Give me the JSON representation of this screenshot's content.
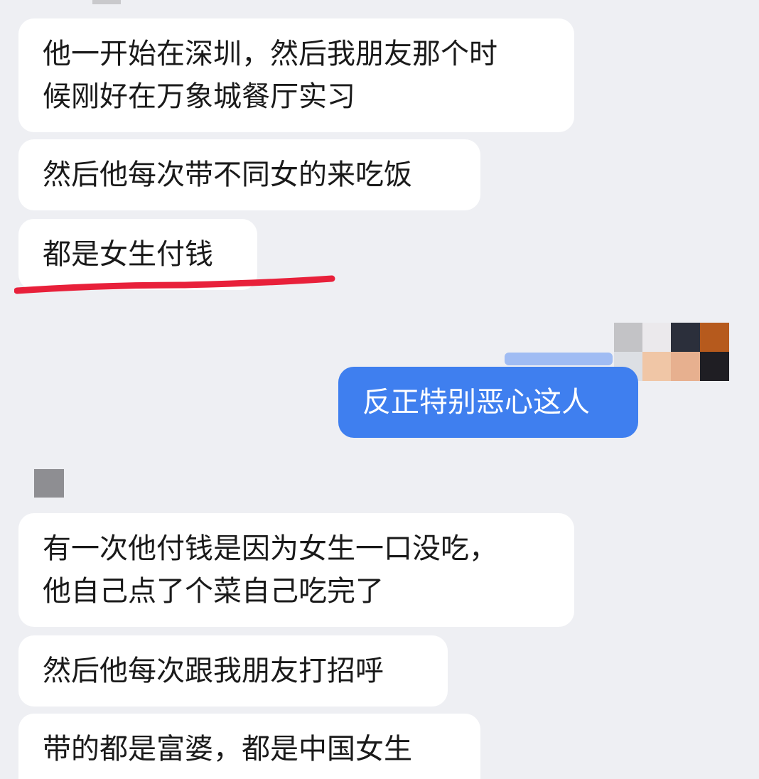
{
  "messages": [
    {
      "lines": [
        "他一开始在深圳，然后我朋友那个时",
        "候刚好在万象城餐厅实习"
      ]
    },
    {
      "lines": [
        "然后他每次带不同女的来吃饭"
      ]
    },
    {
      "lines": [
        "都是女生付钱"
      ]
    },
    {
      "lines": [
        "反正特别恶心这人"
      ],
      "side": "outgoing"
    },
    {
      "lines": [
        "有一次他付钱是因为女生一口没吃，",
        "他自己点了个菜自己吃完了"
      ]
    },
    {
      "lines": [
        "然后他每次跟我朋友打招呼"
      ]
    },
    {
      "lines": [
        "带的都是富婆，都是中国女生"
      ]
    }
  ],
  "colors": {
    "background": "#eeeff3",
    "incoming_bubble": "#ffffff",
    "outgoing_bubble": "#3f7fef",
    "highlight_underline": "#e8203a"
  },
  "icons": {
    "outgoing_avatar": "mosaic-avatar-icon",
    "incoming_avatar": "mosaic-avatar-icon"
  }
}
